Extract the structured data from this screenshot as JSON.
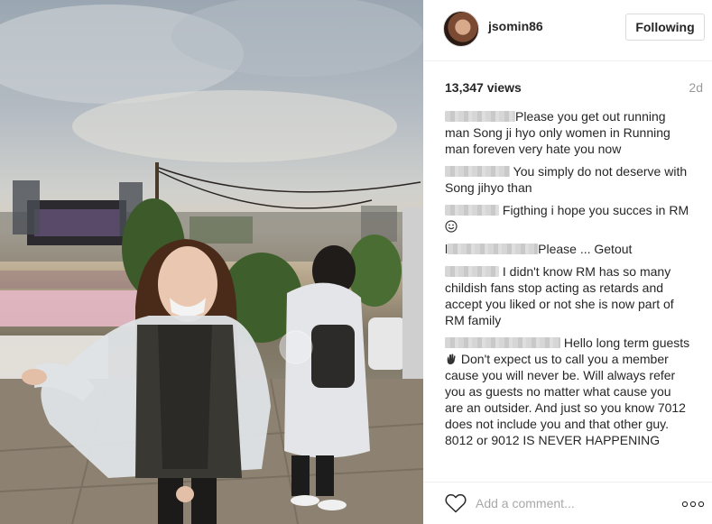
{
  "post": {
    "username": "jsomin86",
    "follow_label": "Following",
    "views": "13,347 views",
    "time_ago": "2d",
    "comment_placeholder": "Add a comment...",
    "more_icon": "ellipsis-icon",
    "like_icon": "heart-icon"
  },
  "comments": [
    {
      "text": "Please you get out running man Song ji hyo only women in Running man foreven very hate you now"
    },
    {
      "text": " You simply do not deserve with Song jihyo than"
    },
    {
      "text": " Figthing i hope you succes in RM ",
      "emoji": "smile-emoji"
    },
    {
      "prefix": "l",
      "text": "Please ... Getout"
    },
    {
      "text": " I didn't know RM has so many childish fans stop acting as retards and accept you liked or not she is now part of RM family"
    },
    {
      "text": " Hello long term guests",
      "emoji": "waving-hand-emoji",
      "text2": " Don't expect us to call you a member cause you will never be. Will always refer you as guests no matter what cause you are an outsider. And just so you know 7012 does not include you and that other guy. 8012 or 9012 IS NEVER HAPPENING"
    }
  ],
  "colors": {
    "muted": "#999999",
    "border": "#dbdbdb",
    "text": "#262626"
  }
}
